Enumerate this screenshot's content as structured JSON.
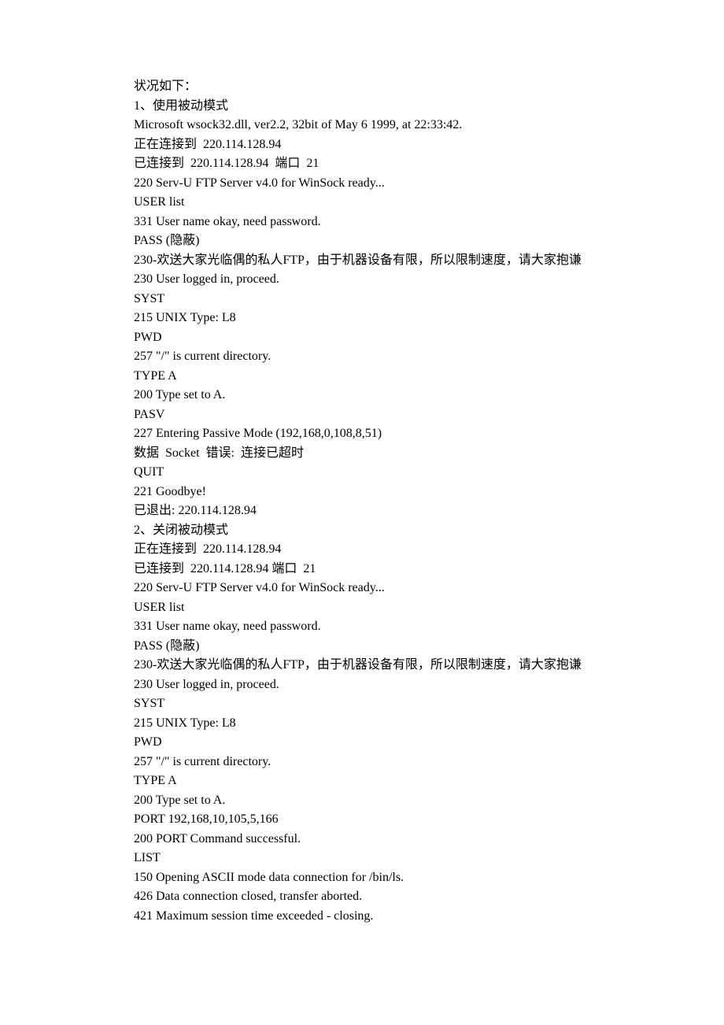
{
  "lines": [
    "状况如下：",
    "1、使用被动模式",
    "Microsoft wsock32.dll, ver2.2, 32bit of May 6 1999, at 22:33:42.",
    "正在连接到  220.114.128.94",
    "已连接到  220.114.128.94  端口  21",
    "220 Serv-U FTP Server v4.0 for WinSock ready...",
    "USER list",
    "331 User name okay, need password.",
    "PASS (隐蔽)",
    "230-欢送大家光临偶的私人FTP，由于机器设备有限，所以限制速度，请大家抱谦",
    "230 User logged in, proceed.",
    "SYST",
    "215 UNIX Type: L8",
    "PWD",
    "257 \"/\" is current directory.",
    "TYPE A",
    "200 Type set to A.",
    "PASV",
    "227 Entering Passive Mode (192,168,0,108,8,51)",
    "数据  Socket  错误:  连接已超时",
    "QUIT",
    "221 Goodbye!",
    "已退出: 220.114.128.94",
    "2、关闭被动模式",
    "正在连接到  220.114.128.94",
    "已连接到  220.114.128.94 端口  21",
    "220 Serv-U FTP Server v4.0 for WinSock ready...",
    "USER list",
    "331 User name okay, need password.",
    "PASS (隐蔽)",
    "230-欢送大家光临偶的私人FTP，由于机器设备有限，所以限制速度，请大家抱谦",
    "230 User logged in, proceed.",
    "SYST",
    "215 UNIX Type: L8",
    "PWD",
    "257 \"/\" is current directory.",
    "TYPE A",
    "200 Type set to A.",
    "PORT 192,168,10,105,5,166",
    "200 PORT Command successful.",
    "LIST",
    "150 Opening ASCII mode data connection for /bin/ls.",
    "426 Data connection closed, transfer aborted.",
    "421 Maximum session time exceeded - closing."
  ]
}
